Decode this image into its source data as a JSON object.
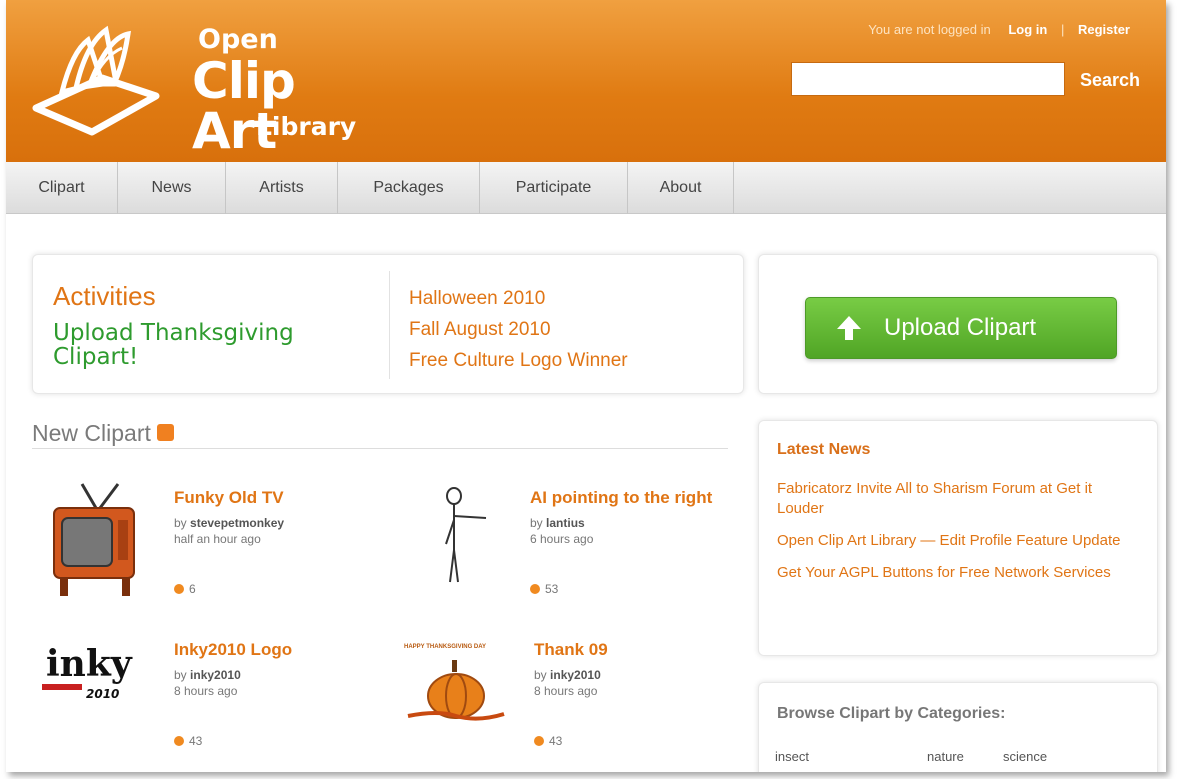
{
  "header": {
    "logo": {
      "line1": "Open",
      "line2": "Clip Art",
      "line3": "Library"
    },
    "account": {
      "status": "You are not logged in",
      "login": "Log in",
      "separator": "|",
      "register": "Register"
    },
    "search": {
      "value": "",
      "button": "Search"
    }
  },
  "nav": {
    "items": [
      {
        "label": "Clipart"
      },
      {
        "label": "News"
      },
      {
        "label": "Artists"
      },
      {
        "label": "Packages"
      },
      {
        "label": "Participate"
      },
      {
        "label": "About"
      }
    ]
  },
  "activities": {
    "title": "Activities",
    "upload_text": "Upload Thanksgiving Clipart!",
    "links": [
      "Halloween 2010",
      "Fall August 2010",
      "Free Culture Logo Winner"
    ]
  },
  "upload": {
    "label": "Upload Clipart",
    "icon": "up-arrow-icon"
  },
  "new_clipart": {
    "title": "New Clipart",
    "items": [
      {
        "title": "Funky Old TV",
        "by_prefix": "by",
        "author": "stevepetmonkey",
        "time": "half an hour ago",
        "count": "6"
      },
      {
        "title": "AI pointing to the right",
        "by_prefix": "by",
        "author": "lantius",
        "time": "6 hours ago",
        "count": "53"
      },
      {
        "title": "Inky2010 Logo",
        "by_prefix": "by",
        "author": "inky2010",
        "time": "8 hours ago",
        "count": "43"
      },
      {
        "title": "Thank 09",
        "by_prefix": "by",
        "author": "inky2010",
        "time": "8 hours ago",
        "count": "43"
      }
    ],
    "thumb_text": {
      "inky": "inky",
      "inky_year": "2010",
      "thanks": "HAPPY THANKSGIVING DAY"
    }
  },
  "news": {
    "title": "Latest News",
    "items": [
      "Fabricatorz Invite All to Sharism Forum at Get it Louder",
      "Open Clip Art Library — Edit Profile Feature Update",
      "Get Your AGPL Buttons for Free Network Services"
    ]
  },
  "browse": {
    "title": "Browse Clipart by Categories:",
    "categories": [
      "insect",
      "nature",
      "science"
    ]
  },
  "colors": {
    "brand_orange": "#e07b12",
    "link_orange": "#e07515",
    "green": "#50a525"
  }
}
